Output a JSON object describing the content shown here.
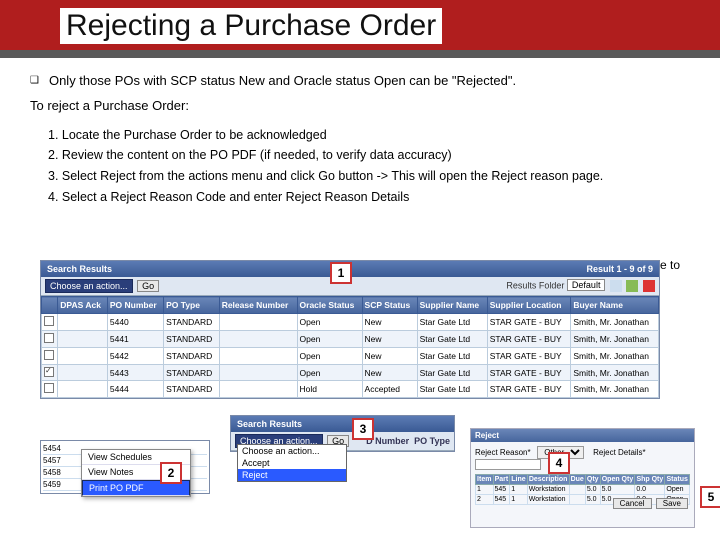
{
  "title": "Rejecting a Purchase Order",
  "bullet": "Only those POs with SCP status New and Oracle status Open can be \"Rejected\".",
  "instruction": "To reject a Purchase Order:",
  "steps": [
    "1. Locate the Purchase Order to be acknowledged",
    "2. Review the content on the PO PDF (if needed, to verify data accuracy)",
    "3. Select Reject from the actions menu and click Go button -> This will open the Reject reason page.",
    "4. Select a Reject Reason Code and enter Reject Reason Details"
  ],
  "cut_text": "e to",
  "shot1": {
    "panel_title": "Search Results",
    "result_count": "Result 1 - 9 of 9",
    "action_select": "Choose an action...",
    "go": "Go",
    "folder_label": "Results Folder",
    "folder_value": "Default",
    "columns": [
      "",
      "DPAS Ack",
      "PO Number",
      "PO Type",
      "Release Number",
      "Oracle Status",
      "SCP Status",
      "Supplier Name",
      "Supplier Location",
      "Buyer Name"
    ],
    "rows": [
      {
        "chk": false,
        "dpas": "",
        "po": "5440",
        "type": "STANDARD",
        "rel": "",
        "oracle": "Open",
        "scp": "New",
        "supplier": "Star Gate Ltd",
        "loc": "STAR GATE - BUY",
        "buyer": "Smith, Mr. Jonathan"
      },
      {
        "chk": false,
        "dpas": "",
        "po": "5441",
        "type": "STANDARD",
        "rel": "",
        "oracle": "Open",
        "scp": "New",
        "supplier": "Star Gate Ltd",
        "loc": "STAR GATE - BUY",
        "buyer": "Smith, Mr. Jonathan"
      },
      {
        "chk": false,
        "dpas": "",
        "po": "5442",
        "type": "STANDARD",
        "rel": "",
        "oracle": "Open",
        "scp": "New",
        "supplier": "Star Gate Ltd",
        "loc": "STAR GATE - BUY",
        "buyer": "Smith, Mr. Jonathan"
      },
      {
        "chk": true,
        "dpas": "",
        "po": "5443",
        "type": "STANDARD",
        "rel": "",
        "oracle": "Open",
        "scp": "New",
        "supplier": "Star Gate Ltd",
        "loc": "STAR GATE - BUY",
        "buyer": "Smith, Mr. Jonathan"
      },
      {
        "chk": false,
        "dpas": "",
        "po": "5444",
        "type": "STANDARD",
        "rel": "",
        "oracle": "Hold",
        "scp": "Accepted",
        "supplier": "Star Gate Ltd",
        "loc": "STAR GATE - BUY",
        "buyer": "Smith, Mr. Jonathan"
      }
    ]
  },
  "shot2": {
    "nums": [
      "5454",
      "5457",
      "5458",
      "5459"
    ],
    "menu": [
      "View Schedules",
      "View Notes",
      "Print PO PDF"
    ],
    "selected": 2
  },
  "shot3": {
    "panel_title": "Search Results",
    "action_select": "Choose an action...",
    "go": "Go",
    "cols": [
      "D Number",
      "PO Type"
    ],
    "options": [
      "Choose an action...",
      "Accept",
      "Reject"
    ],
    "highlight": 2
  },
  "shot4": {
    "panel_title": "Reject",
    "reason_label": "Reject Reason*",
    "reason_value": "Other",
    "detail_label": "Reject Details*",
    "cancel": "Cancel",
    "save": "Save",
    "cols": [
      "Item",
      "Part",
      "Line",
      "Description",
      "Due",
      "Qty",
      "Open Qty",
      "Shp Qty",
      "Status"
    ],
    "rows": [
      [
        "1",
        "545",
        "1",
        "Workstation",
        "",
        "5.0",
        "5.0",
        "0.0",
        "Open"
      ],
      [
        "2",
        "545",
        "1",
        "Workstation",
        "",
        "5.0",
        "5.0",
        "0.0",
        "Open"
      ]
    ]
  },
  "balloons": {
    "b1": "1",
    "b2": "2",
    "b3": "3",
    "b4": "4",
    "b5": "5"
  }
}
